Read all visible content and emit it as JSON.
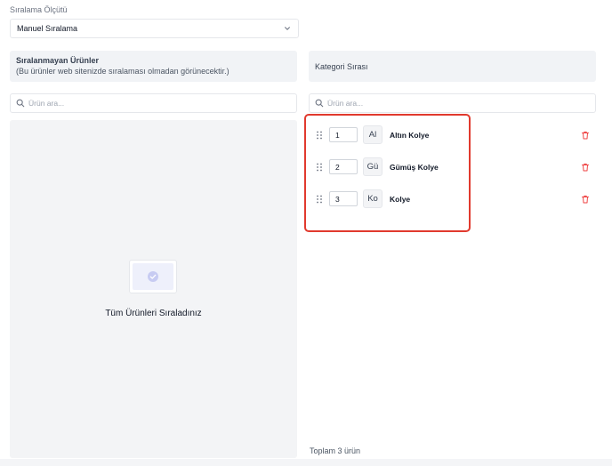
{
  "criterion": {
    "label": "Sıralama Ölçütü",
    "selected": "Manuel Sıralama"
  },
  "unsorted": {
    "title": "Sıralanmayan Ürünler",
    "subtitle": "(Bu ürünler web sitenizde sıralaması olmadan görünecektir.)",
    "search_placeholder": "Ürün ara...",
    "empty_message": "Tüm Ürünleri Sıraladınız"
  },
  "sorted": {
    "title": "Kategori Sırası",
    "search_placeholder": "Ürün ara...",
    "items": [
      {
        "order": "1",
        "thumb": "Al",
        "name": "Altın Kolye"
      },
      {
        "order": "2",
        "thumb": "Gü",
        "name": "Gümüş Kolye"
      },
      {
        "order": "3",
        "thumb": "Ko",
        "name": "Kolye"
      }
    ],
    "total_text": "Toplam 3 ürün"
  },
  "colors": {
    "highlight": "#e13a2e",
    "delete": "#ef4444",
    "panel_bg": "#f1f3f6"
  },
  "icons": {
    "search": "search-icon",
    "chevron": "chevron-down-icon",
    "drag": "drag-handle-icon",
    "delete": "trash-icon",
    "empty": "check-circle-icon"
  }
}
